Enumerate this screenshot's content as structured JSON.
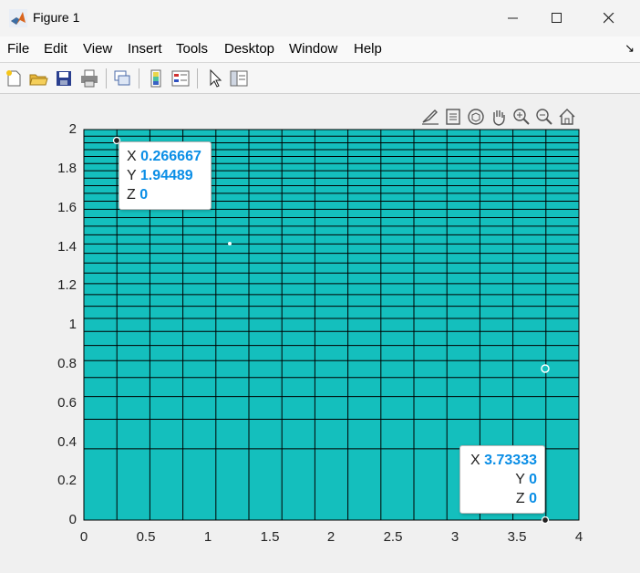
{
  "window": {
    "title": "Figure 1"
  },
  "menu": [
    "File",
    "Edit",
    "View",
    "Insert",
    "Tools",
    "Desktop",
    "Window",
    "Help"
  ],
  "plot": {
    "yticks": [
      "0",
      "0.2",
      "0.4",
      "0.6",
      "0.8",
      "1",
      "1.2",
      "1.4",
      "1.6",
      "1.8",
      "2"
    ],
    "xticks": [
      "0",
      "0.5",
      "1",
      "1.5",
      "2",
      "2.5",
      "3",
      "3.5",
      "4"
    ],
    "surface_color": "#14bfbd"
  },
  "datatips": [
    {
      "x_label": "X",
      "x": "0.266667",
      "y_label": "Y",
      "y": "1.94489",
      "z_label": "Z",
      "z": "0"
    },
    {
      "x_label": "X",
      "x": "3.73333",
      "y_label": "Y",
      "y": "0",
      "z_label": "Z",
      "z": "0"
    }
  ],
  "chart_data": {
    "type": "heatmap",
    "xlim": [
      0,
      4
    ],
    "ylim": [
      0,
      2
    ],
    "grid": true,
    "datatips": [
      {
        "x": 0.266667,
        "y": 1.94489,
        "z": 0
      },
      {
        "x": 3.73333,
        "y": 0,
        "z": 0
      }
    ]
  }
}
